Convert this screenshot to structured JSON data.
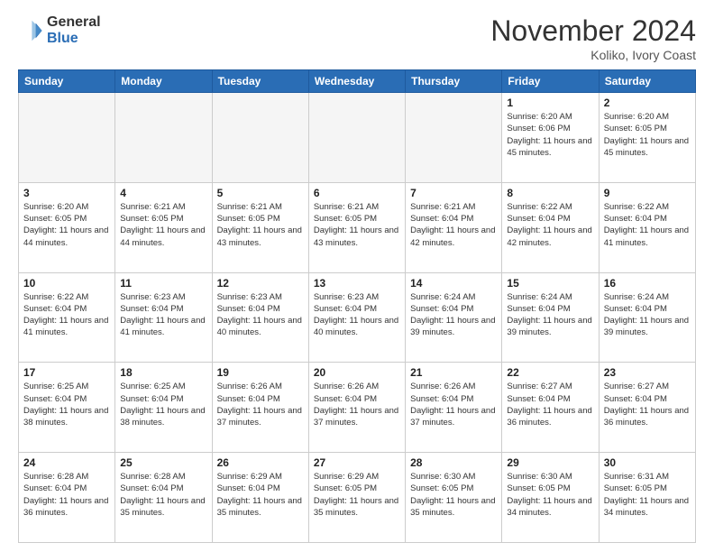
{
  "header": {
    "logo_general": "General",
    "logo_blue": "Blue",
    "month_title": "November 2024",
    "location": "Koliko, Ivory Coast"
  },
  "weekdays": [
    "Sunday",
    "Monday",
    "Tuesday",
    "Wednesday",
    "Thursday",
    "Friday",
    "Saturday"
  ],
  "weeks": [
    [
      {
        "day": "",
        "info": ""
      },
      {
        "day": "",
        "info": ""
      },
      {
        "day": "",
        "info": ""
      },
      {
        "day": "",
        "info": ""
      },
      {
        "day": "",
        "info": ""
      },
      {
        "day": "1",
        "info": "Sunrise: 6:20 AM\nSunset: 6:06 PM\nDaylight: 11 hours and 45 minutes."
      },
      {
        "day": "2",
        "info": "Sunrise: 6:20 AM\nSunset: 6:05 PM\nDaylight: 11 hours and 45 minutes."
      }
    ],
    [
      {
        "day": "3",
        "info": "Sunrise: 6:20 AM\nSunset: 6:05 PM\nDaylight: 11 hours and 44 minutes."
      },
      {
        "day": "4",
        "info": "Sunrise: 6:21 AM\nSunset: 6:05 PM\nDaylight: 11 hours and 44 minutes."
      },
      {
        "day": "5",
        "info": "Sunrise: 6:21 AM\nSunset: 6:05 PM\nDaylight: 11 hours and 43 minutes."
      },
      {
        "day": "6",
        "info": "Sunrise: 6:21 AM\nSunset: 6:05 PM\nDaylight: 11 hours and 43 minutes."
      },
      {
        "day": "7",
        "info": "Sunrise: 6:21 AM\nSunset: 6:04 PM\nDaylight: 11 hours and 42 minutes."
      },
      {
        "day": "8",
        "info": "Sunrise: 6:22 AM\nSunset: 6:04 PM\nDaylight: 11 hours and 42 minutes."
      },
      {
        "day": "9",
        "info": "Sunrise: 6:22 AM\nSunset: 6:04 PM\nDaylight: 11 hours and 41 minutes."
      }
    ],
    [
      {
        "day": "10",
        "info": "Sunrise: 6:22 AM\nSunset: 6:04 PM\nDaylight: 11 hours and 41 minutes."
      },
      {
        "day": "11",
        "info": "Sunrise: 6:23 AM\nSunset: 6:04 PM\nDaylight: 11 hours and 41 minutes."
      },
      {
        "day": "12",
        "info": "Sunrise: 6:23 AM\nSunset: 6:04 PM\nDaylight: 11 hours and 40 minutes."
      },
      {
        "day": "13",
        "info": "Sunrise: 6:23 AM\nSunset: 6:04 PM\nDaylight: 11 hours and 40 minutes."
      },
      {
        "day": "14",
        "info": "Sunrise: 6:24 AM\nSunset: 6:04 PM\nDaylight: 11 hours and 39 minutes."
      },
      {
        "day": "15",
        "info": "Sunrise: 6:24 AM\nSunset: 6:04 PM\nDaylight: 11 hours and 39 minutes."
      },
      {
        "day": "16",
        "info": "Sunrise: 6:24 AM\nSunset: 6:04 PM\nDaylight: 11 hours and 39 minutes."
      }
    ],
    [
      {
        "day": "17",
        "info": "Sunrise: 6:25 AM\nSunset: 6:04 PM\nDaylight: 11 hours and 38 minutes."
      },
      {
        "day": "18",
        "info": "Sunrise: 6:25 AM\nSunset: 6:04 PM\nDaylight: 11 hours and 38 minutes."
      },
      {
        "day": "19",
        "info": "Sunrise: 6:26 AM\nSunset: 6:04 PM\nDaylight: 11 hours and 37 minutes."
      },
      {
        "day": "20",
        "info": "Sunrise: 6:26 AM\nSunset: 6:04 PM\nDaylight: 11 hours and 37 minutes."
      },
      {
        "day": "21",
        "info": "Sunrise: 6:26 AM\nSunset: 6:04 PM\nDaylight: 11 hours and 37 minutes."
      },
      {
        "day": "22",
        "info": "Sunrise: 6:27 AM\nSunset: 6:04 PM\nDaylight: 11 hours and 36 minutes."
      },
      {
        "day": "23",
        "info": "Sunrise: 6:27 AM\nSunset: 6:04 PM\nDaylight: 11 hours and 36 minutes."
      }
    ],
    [
      {
        "day": "24",
        "info": "Sunrise: 6:28 AM\nSunset: 6:04 PM\nDaylight: 11 hours and 36 minutes."
      },
      {
        "day": "25",
        "info": "Sunrise: 6:28 AM\nSunset: 6:04 PM\nDaylight: 11 hours and 35 minutes."
      },
      {
        "day": "26",
        "info": "Sunrise: 6:29 AM\nSunset: 6:04 PM\nDaylight: 11 hours and 35 minutes."
      },
      {
        "day": "27",
        "info": "Sunrise: 6:29 AM\nSunset: 6:05 PM\nDaylight: 11 hours and 35 minutes."
      },
      {
        "day": "28",
        "info": "Sunrise: 6:30 AM\nSunset: 6:05 PM\nDaylight: 11 hours and 35 minutes."
      },
      {
        "day": "29",
        "info": "Sunrise: 6:30 AM\nSunset: 6:05 PM\nDaylight: 11 hours and 34 minutes."
      },
      {
        "day": "30",
        "info": "Sunrise: 6:31 AM\nSunset: 6:05 PM\nDaylight: 11 hours and 34 minutes."
      }
    ]
  ]
}
